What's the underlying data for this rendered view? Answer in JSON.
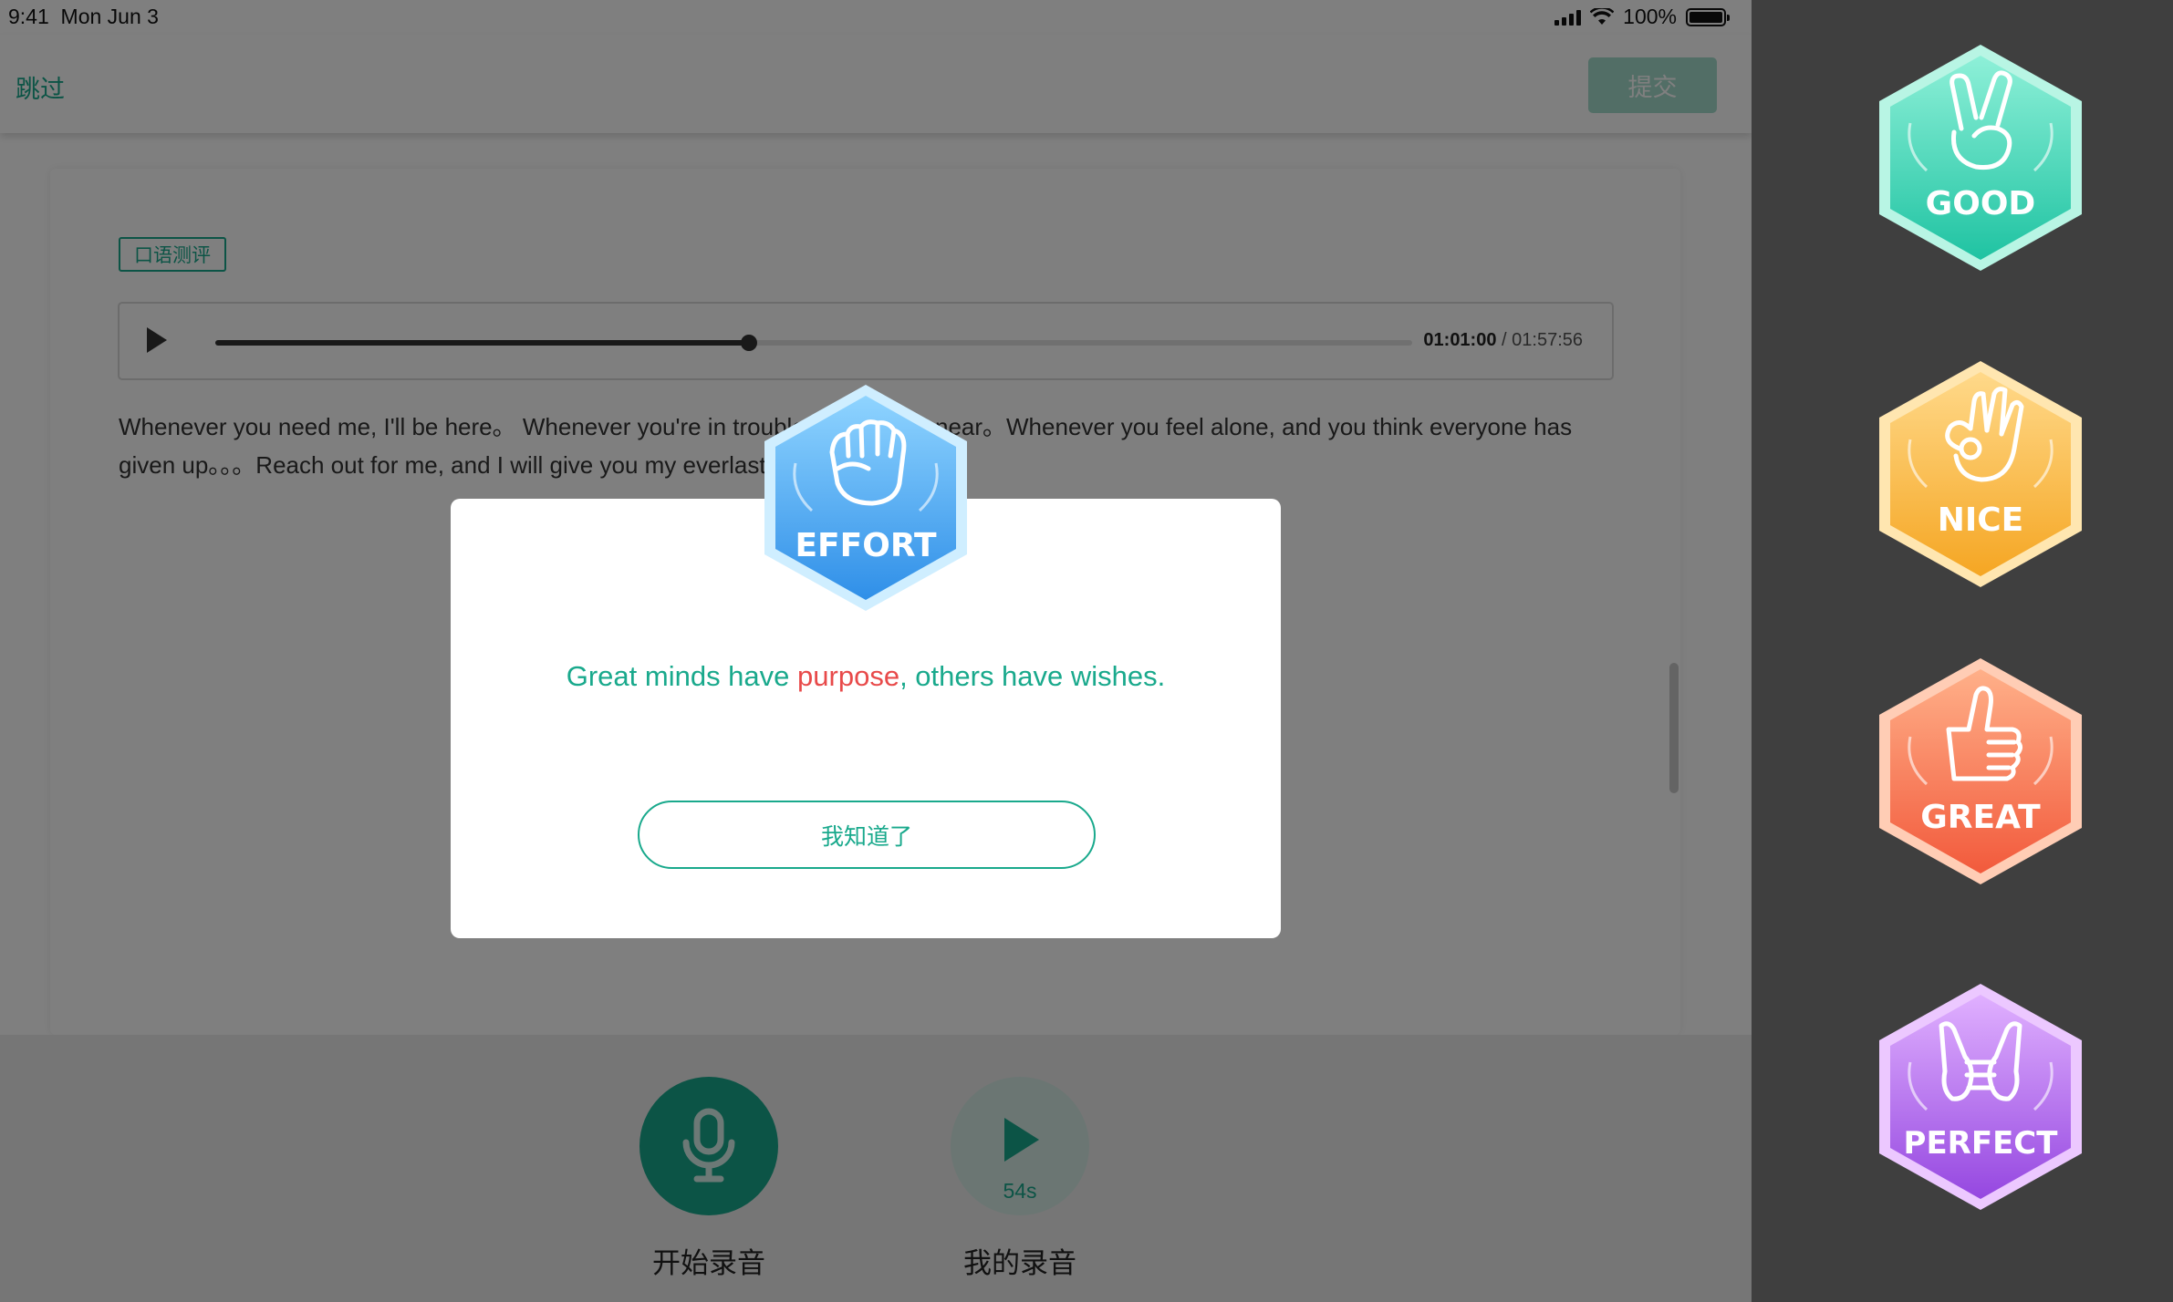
{
  "status_bar": {
    "time": "9:41",
    "date": "Mon Jun 3",
    "battery": "100%"
  },
  "nav": {
    "skip": "跳过",
    "submit": "提交"
  },
  "question": {
    "tag": "口语测评",
    "audio": {
      "current": "01:01:00",
      "separator": " / ",
      "total": "01:57:56",
      "progress": 0.446
    },
    "passage": "Whenever you need me,  I'll be here。 Whenever you're in trouble, I'm always near。Whenever you feel alone,  and you think everyone has given up。。。Reach out for me,  and I will give you my everlasting love。"
  },
  "bottom": {
    "record_label": "开始录音",
    "my_recording_label": "我的录音",
    "my_recording_duration": "54s"
  },
  "modal": {
    "badge": "EFFORT",
    "motto_part1": "Great minds have ",
    "motto_highlight": "purpose",
    "motto_part2": ", others have wishes.",
    "button": "我知道了"
  },
  "badges": {
    "good": "GOOD",
    "nice": "NICE",
    "great": "GREAT",
    "perfect": "PERFECT"
  },
  "colors": {
    "accent": "#19a98c",
    "highlight": "#e84a4a",
    "effort": "#3aa6f0",
    "good": "#2fd1b0",
    "nice": "#f6b23c",
    "great": "#f46d4a",
    "perfect": "#a65ae6"
  }
}
